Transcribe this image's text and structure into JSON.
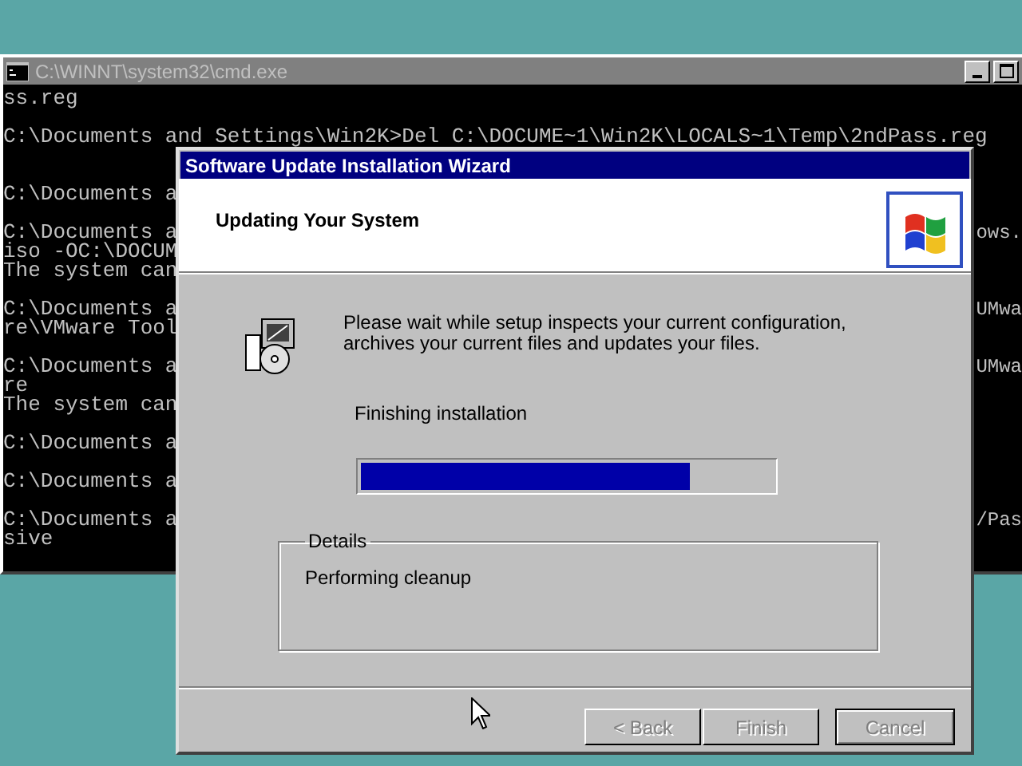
{
  "console_window": {
    "title": "C:\\WINNT\\system32\\cmd.exe",
    "active": false,
    "lines": [
      {
        "kind": "text",
        "left": "ss.reg"
      },
      {
        "kind": "blank"
      },
      {
        "kind": "text",
        "left": "C:\\Documents and Settings\\Win2K>Del C:\\DOCUME~1\\Win2K\\LOCALS~1\\Temp\\2ndPass.reg"
      },
      {
        "kind": "blank"
      },
      {
        "kind": "blank"
      },
      {
        "kind": "text",
        "left": "C:\\Documents a"
      },
      {
        "kind": "blank"
      },
      {
        "kind": "text",
        "left": "C:\\Documents a",
        "right": "ows."
      },
      {
        "kind": "text",
        "left": "iso -OC:\\DOCUM"
      },
      {
        "kind": "text",
        "left": "The system can"
      },
      {
        "kind": "blank"
      },
      {
        "kind": "text",
        "left": "C:\\Documents a",
        "right": "UMwa"
      },
      {
        "kind": "text",
        "left": "re\\VMware Tool"
      },
      {
        "kind": "blank"
      },
      {
        "kind": "text",
        "left": "C:\\Documents a",
        "right": "UMwa"
      },
      {
        "kind": "text",
        "left": "re"
      },
      {
        "kind": "text",
        "left": "The system can"
      },
      {
        "kind": "blank"
      },
      {
        "kind": "text",
        "left": "C:\\Documents a"
      },
      {
        "kind": "blank"
      },
      {
        "kind": "text",
        "left": "C:\\Documents a"
      },
      {
        "kind": "blank"
      },
      {
        "kind": "text",
        "left": "C:\\Documents a",
        "right": "/Pas"
      },
      {
        "kind": "text",
        "left": "sive"
      }
    ]
  },
  "wizard": {
    "title": "Software Update Installation Wizard",
    "active": true,
    "header": "Updating Your System",
    "message": "Please wait while setup inspects your current configuration, archives your current files and updates your files.",
    "status": "Finishing installation",
    "progress": {
      "level": 0.8
    },
    "details": {
      "label": "Details",
      "text": "Performing cleanup"
    },
    "buttons": [
      {
        "label": "< Back",
        "disabled": true,
        "default": false
      },
      {
        "label": "Finish",
        "disabled": true,
        "default": false
      },
      {
        "label": "Cancel",
        "disabled": true,
        "default": true
      }
    ]
  }
}
